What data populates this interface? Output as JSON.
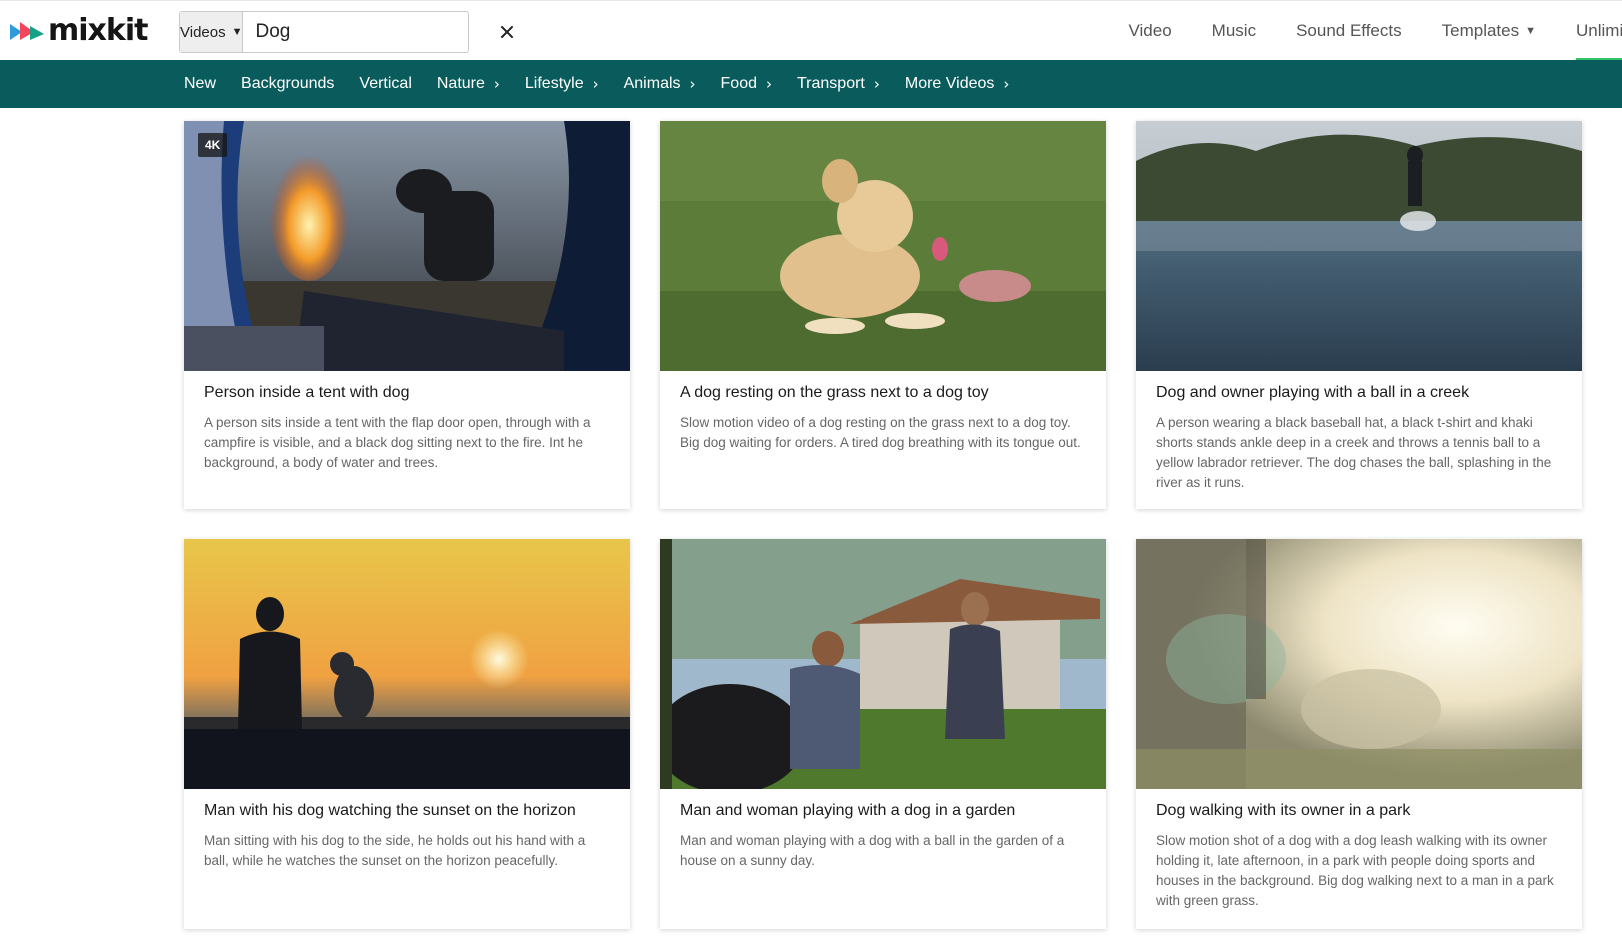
{
  "brand": {
    "name": "mixkit"
  },
  "search": {
    "type_label": "Videos",
    "query": "Dog"
  },
  "topnav": [
    {
      "label": "Video"
    },
    {
      "label": "Music"
    },
    {
      "label": "Sound Effects"
    },
    {
      "label": "Templates"
    },
    {
      "label": "Unlimi"
    }
  ],
  "categories": [
    {
      "label": "New"
    },
    {
      "label": "Backgrounds"
    },
    {
      "label": "Vertical"
    },
    {
      "label": "Nature"
    },
    {
      "label": "Lifestyle"
    },
    {
      "label": "Animals"
    },
    {
      "label": "Food"
    },
    {
      "label": "Transport"
    },
    {
      "label": "More Videos"
    }
  ],
  "videos": [
    {
      "badge": "4K",
      "title": "Person inside a tent with dog",
      "description": "A person sits inside a tent with the flap door open, through with a campfire is visible, and a black dog sitting next to the fire. Int he background, a body of water and trees."
    },
    {
      "title": "A dog resting on the grass next to a dog toy",
      "description": "Slow motion video of a dog resting on the grass next to a dog toy. Big dog waiting for orders. A tired dog breathing with its tongue out."
    },
    {
      "title": "Dog and owner playing with a ball in a creek",
      "description": "A person wearing a black baseball hat, a black t-shirt and khaki shorts stands ankle deep in a creek and throws a tennis ball to a yellow labrador retriever. The dog chases the ball, splashing in the river as it runs."
    },
    {
      "title": "Man with his dog watching the sunset on the horizon",
      "description": "Man sitting with his dog to the side, he holds out his hand with a ball, while he watches the sunset on the horizon peacefully."
    },
    {
      "title": "Man and woman playing with a dog in a garden",
      "description": "Man and woman playing with a dog with a ball in the garden of a house on a sunny day."
    },
    {
      "title": "Dog walking with its owner in a park",
      "description": "Slow motion shot of a dog with a dog leash walking with its owner holding it, late afternoon, in a park with people doing sports and houses in the background. Big dog walking next to a man in a park with green grass."
    }
  ]
}
